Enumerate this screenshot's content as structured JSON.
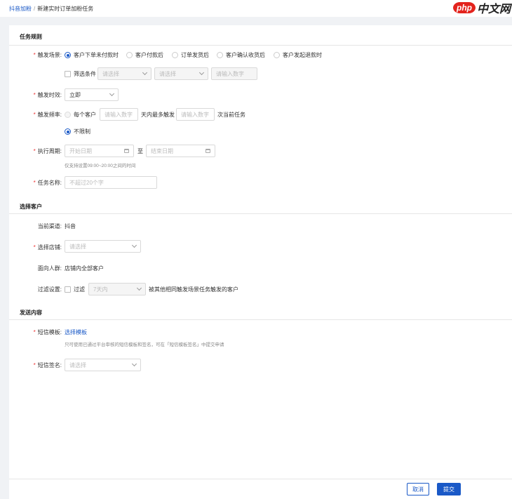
{
  "breadcrumb": {
    "parent": "抖音加粉",
    "separator": "/",
    "current": "新建实时订单加粉任务"
  },
  "logo": {
    "php": "php",
    "cn": "中文网"
  },
  "sections": {
    "rules": "任务规则",
    "customers": "选择客户",
    "content": "发送内容"
  },
  "trigger_scene": {
    "label": "触发场景:",
    "options": [
      "客户下单未付款时",
      "客户付款后",
      "订单发货后",
      "客户确认收货后",
      "客户发起退款时"
    ],
    "selected_index": 0
  },
  "filter": {
    "label": "筛选条件",
    "select1_placeholder": "请选择",
    "select2_placeholder": "请选择",
    "input_placeholder": "请输入数字"
  },
  "trigger_timing": {
    "label": "触发时效:",
    "value": "立即"
  },
  "trigger_frequency": {
    "label": "触发频率:",
    "each_customer": "每个客户",
    "days_placeholder": "请输入数字",
    "days_text": "天内最多触发",
    "times_placeholder": "请输入数字",
    "times_text": "次当前任务",
    "unlimited": "不限制"
  },
  "period": {
    "label": "执行周期:",
    "start_placeholder": "开始日期",
    "to": "至",
    "end_placeholder": "结束日期",
    "hint": "仅支持设置09:00~20:00之间的时间"
  },
  "task_name": {
    "label": "任务名称:",
    "placeholder": "不超过20个字"
  },
  "channel": {
    "label": "当前渠道:",
    "value": "抖音"
  },
  "shop": {
    "label": "选择店铺:",
    "placeholder": "请选择"
  },
  "audience": {
    "label": "面向人群:",
    "value": "店铺内全部客户"
  },
  "filter_setting": {
    "label": "过滤设置:",
    "checkbox": "过滤",
    "select_value": "7天内",
    "suffix": "被其他相同触发场景任务触发的客户"
  },
  "sms_template": {
    "label": "短信模板:",
    "link": "选择模板",
    "hint": "只可使用已通过平台审核的短信模板和签名，可在「短信模板签名」中提交申请"
  },
  "sms_signature": {
    "label": "短信签名:",
    "placeholder": "请选择"
  },
  "buttons": {
    "cancel": "取消",
    "submit": "提交"
  },
  "required_mark": "*"
}
